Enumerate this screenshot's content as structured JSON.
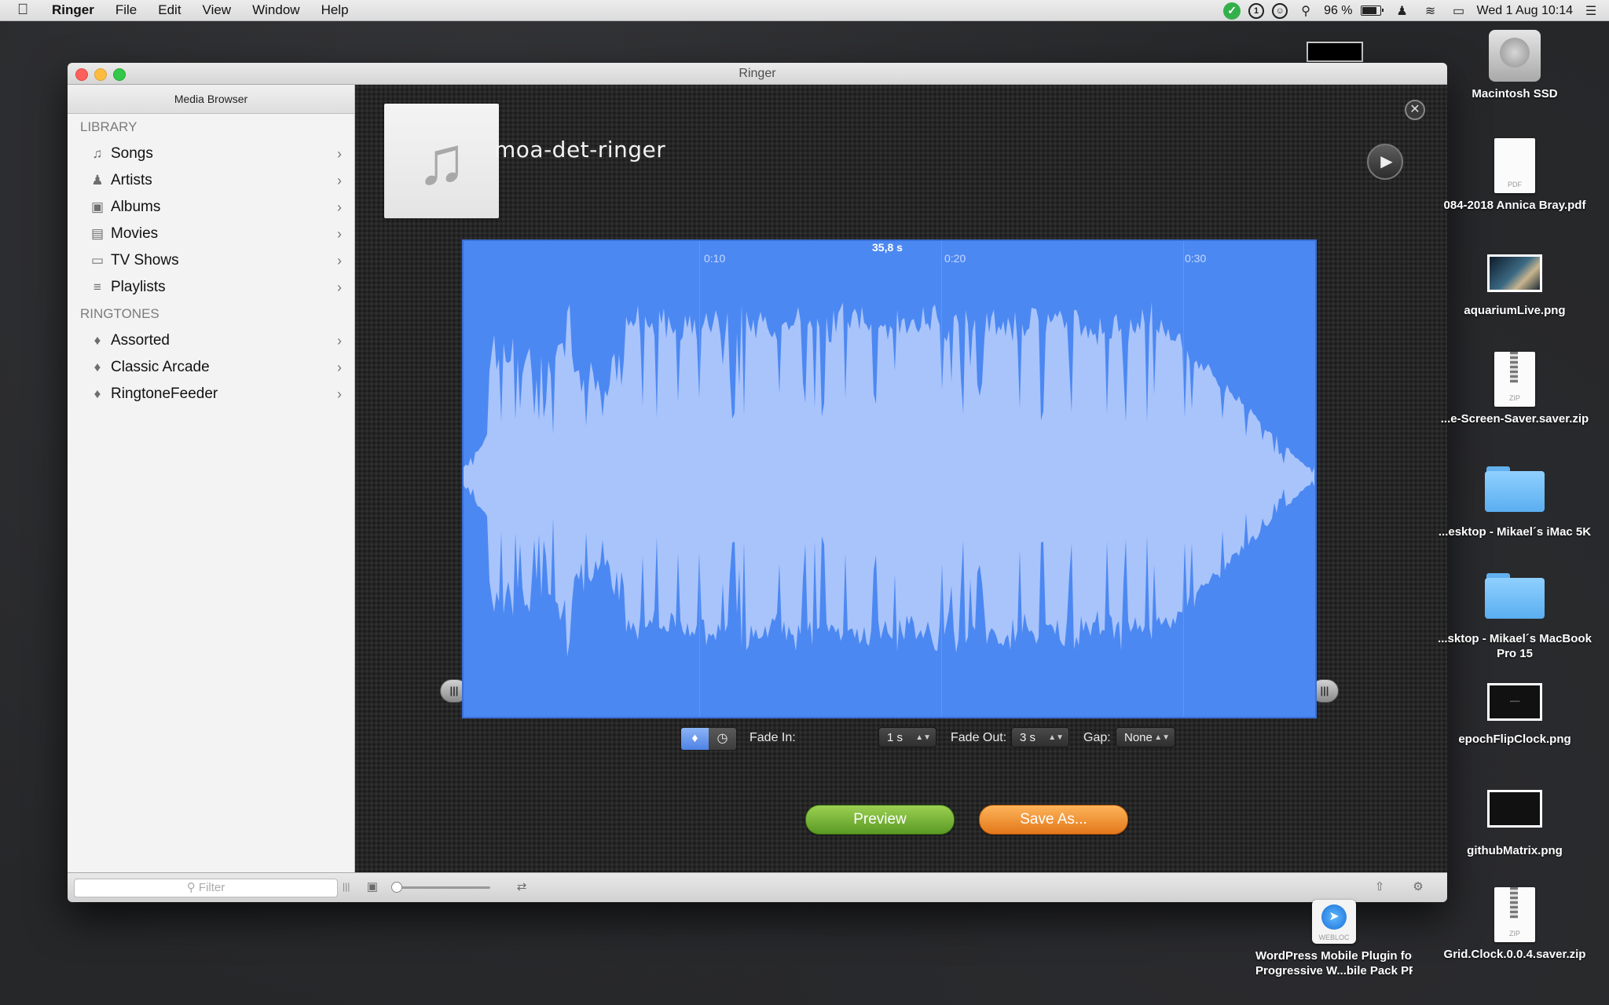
{
  "menubar": {
    "apple": "",
    "app_name": "Ringer",
    "menus": [
      "File",
      "Edit",
      "View",
      "Window",
      "Help"
    ],
    "battery": "96 %",
    "datetime": "Wed 1 Aug  10:14"
  },
  "window": {
    "title": "Ringer"
  },
  "sidebar": {
    "header": "Media Browser",
    "library_title": "LIBRARY",
    "library_items": [
      {
        "label": "Songs",
        "icon": "music-note-icon"
      },
      {
        "label": "Artists",
        "icon": "person-icon"
      },
      {
        "label": "Albums",
        "icon": "album-icon"
      },
      {
        "label": "Movies",
        "icon": "film-icon"
      },
      {
        "label": "TV Shows",
        "icon": "tv-icon"
      },
      {
        "label": "Playlists",
        "icon": "playlist-icon"
      }
    ],
    "ringtones_title": "RINGTONES",
    "ringtone_items": [
      {
        "label": "Assorted",
        "icon": "bell-icon"
      },
      {
        "label": "Classic Arcade",
        "icon": "bell-icon"
      },
      {
        "label": "RingtoneFeeder",
        "icon": "bell-icon"
      }
    ],
    "filter_placeholder": "Filter"
  },
  "track": {
    "title": "moa-det-ringer"
  },
  "waveform": {
    "duration_label": "35,8 s",
    "ticks": [
      "0:10",
      "0:20",
      "0:30"
    ],
    "color": "#4c88f2",
    "wave_color": "#a9c4fb"
  },
  "controls": {
    "fade_in_label": "Fade In:",
    "fade_in_value": "1 s",
    "fade_out_label": "Fade Out:",
    "fade_out_value": "3 s",
    "gap_label": "Gap:",
    "gap_value": "None"
  },
  "buttons": {
    "preview": "Preview",
    "save_as": "Save As..."
  },
  "desktop": [
    {
      "label": "Macintosh SSD",
      "kind": "hdd"
    },
    {
      "label": "084-2018 Annica Bray.pdf",
      "kind": "pdf",
      "tag": "PDF"
    },
    {
      "label": "aquariumLive.png",
      "kind": "image"
    },
    {
      "label": "...e-Screen-Saver.saver.zip",
      "kind": "zip",
      "tag": "ZIP"
    },
    {
      "label": "...esktop - Mikael´s iMac 5K",
      "kind": "folder"
    },
    {
      "label": "...sktop - Mikael´s MacBook",
      "label2": "Pro 15",
      "kind": "folder"
    },
    {
      "label": "epochFlipClock.png",
      "kind": "image"
    },
    {
      "label": "githubMatrix.png",
      "kind": "image"
    },
    {
      "label": "Grid.Clock.0.0.4.saver.zip",
      "kind": "zip",
      "tag": "ZIP"
    },
    {
      "label": "WordPress Mobile Plugin for",
      "label2": "Progressive W...bile Pack PRO",
      "kind": "webloc",
      "tag": "WEBLOC"
    }
  ]
}
